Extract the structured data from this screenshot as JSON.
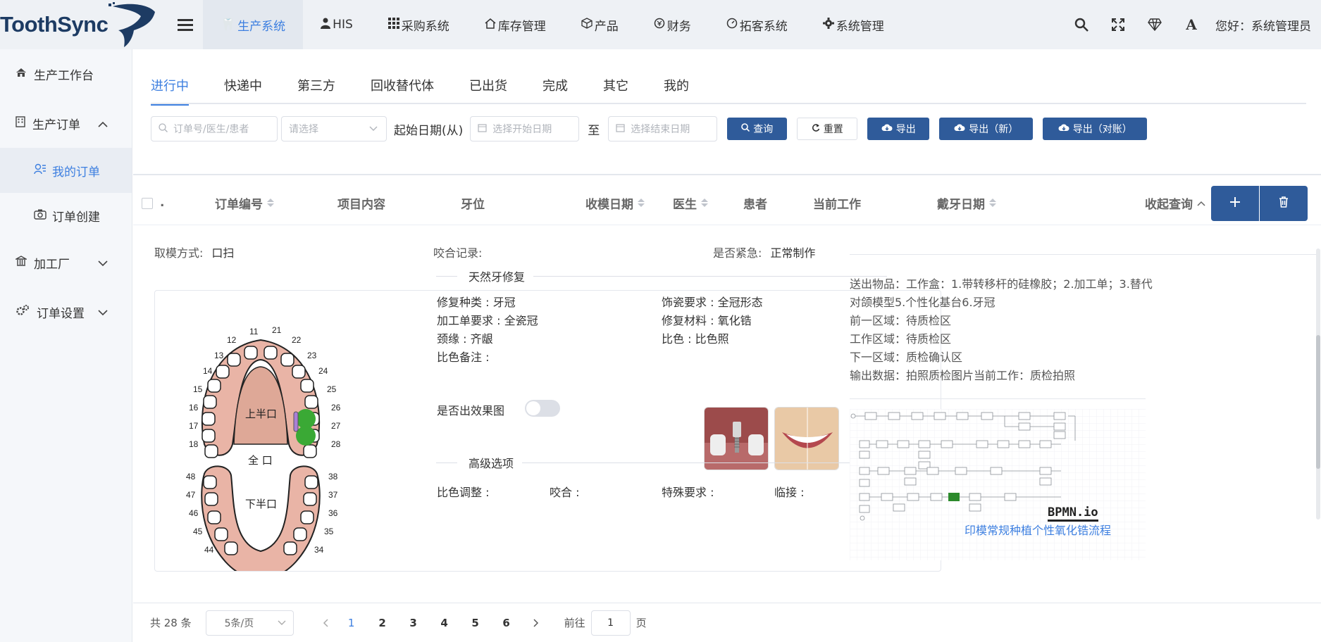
{
  "logo": {
    "text": "ToothSync"
  },
  "topnav": {
    "items": [
      {
        "label": "生产系统",
        "icon": "tooth-icon",
        "active": true
      },
      {
        "label": "HIS",
        "icon": "user-doctor-icon",
        "active": false
      },
      {
        "label": "采购系统",
        "icon": "grid-icon",
        "active": false
      },
      {
        "label": "库存管理",
        "icon": "house-icon",
        "active": false
      },
      {
        "label": "产品",
        "icon": "cube-icon",
        "active": false
      },
      {
        "label": "财务",
        "icon": "yen-circle-icon",
        "active": false
      },
      {
        "label": "拓客系统",
        "icon": "gauge-icon",
        "active": false
      },
      {
        "label": "系统管理",
        "icon": "gear-icon",
        "active": false
      }
    ],
    "greeting": "您好：系统管理员"
  },
  "sidebar": {
    "items": [
      {
        "label": "生产工作台",
        "icon": "home-icon"
      },
      {
        "label": "生产订单",
        "icon": "building-icon",
        "expanded": true
      },
      {
        "label": "我的订单",
        "icon": "user-group-icon",
        "active": true
      },
      {
        "label": "订单创建",
        "icon": "camera-icon"
      },
      {
        "label": "加工厂",
        "icon": "bank-icon",
        "expanded": false
      },
      {
        "label": "订单设置",
        "icon": "gears-icon",
        "expanded": false
      }
    ]
  },
  "tabs": [
    "进行中",
    "快递中",
    "第三方",
    "回收替代体",
    "已出货",
    "完成",
    "其它",
    "我的"
  ],
  "filters": {
    "search_placeholder": "订单号/医生/患者",
    "select_placeholder": "请选择",
    "date_from_label": "起始日期(从)",
    "start_placeholder": "选择开始日期",
    "to_label": "至",
    "end_placeholder": "选择结束日期",
    "buttons": {
      "query": "查询",
      "reset": "重置",
      "export": "导出",
      "export_new": "导出（新）",
      "export_reconcile": "导出（对账）"
    }
  },
  "table": {
    "dot": ".",
    "columns": [
      "订单编号",
      "项目内容",
      "牙位",
      "收模日期",
      "医生",
      "患者",
      "当前工作",
      "戴牙日期"
    ],
    "collapse_label": "收起查询"
  },
  "detail": {
    "impression_label": "取模方式:",
    "impression_value": "口扫",
    "bite_label": "咬合记录:",
    "bite_value": "",
    "urgent_label": "是否紧急:",
    "urgent_value": "正常制作",
    "section_restore": "天然牙修复",
    "fields": {
      "repair_type": "修复种类 : 牙冠",
      "porcelain_req": "饰瓷要求 : 全冠形态",
      "process_req": "加工单要求 : 全瓷冠",
      "material": "修复材料 : 氧化锆",
      "margin": "颈缘 : 齐龈",
      "shade": "比色 : 比色照",
      "shade_note": "比色备注 :"
    },
    "effect_label": "是否出效果图",
    "effect_on": false,
    "section_advanced": "高级选项",
    "advanced": {
      "shade_adjust": "比色调整 :",
      "occlusion": "咬合 :",
      "special": "特殊要求 :",
      "adjacent": "临接 :"
    }
  },
  "tooth_chart": {
    "upper_label": "上半口",
    "full_label": "全 口",
    "lower_label": "下半口",
    "upper_numbers": [
      "11",
      "21",
      "12",
      "22",
      "13",
      "23",
      "14",
      "24",
      "15",
      "25",
      "16",
      "26",
      "17",
      "27",
      "18",
      "28"
    ],
    "lower_numbers": [
      "48",
      "38",
      "47",
      "37",
      "46",
      "36",
      "45",
      "35",
      "44",
      "34"
    ],
    "selected_teeth": [
      "26",
      "27"
    ],
    "selected_color": "#3aa935",
    "bridge_color": "#a97fd6"
  },
  "right_info": {
    "send_items": "送出物品：工作盒：1.带转移杆的硅橡胶；2.加工单；3.替代",
    "send_items_2": "对颌模型5.个性化基台6.牙冠",
    "prev_area": "前一区域：待质检区",
    "work_area": "工作区域：待质检区",
    "next_area": "下一区域：质检确认区",
    "output": "输出数据：拍照质检图片当前工作：质检拍照",
    "bpmn_brand": "BPMN.io",
    "flow_link": "印模常规种植个性氧化锆流程"
  },
  "pagination": {
    "total": "共 28 条",
    "page_size": "5条/页",
    "pages": [
      "1",
      "2",
      "3",
      "4",
      "5",
      "6"
    ],
    "current": "1",
    "goto_label": "前往",
    "goto_value": "1",
    "page_unit": "页"
  },
  "colors": {
    "accent": "#3d7fe0",
    "button": "#2f5b9a",
    "gum": "#e9b4a6"
  }
}
